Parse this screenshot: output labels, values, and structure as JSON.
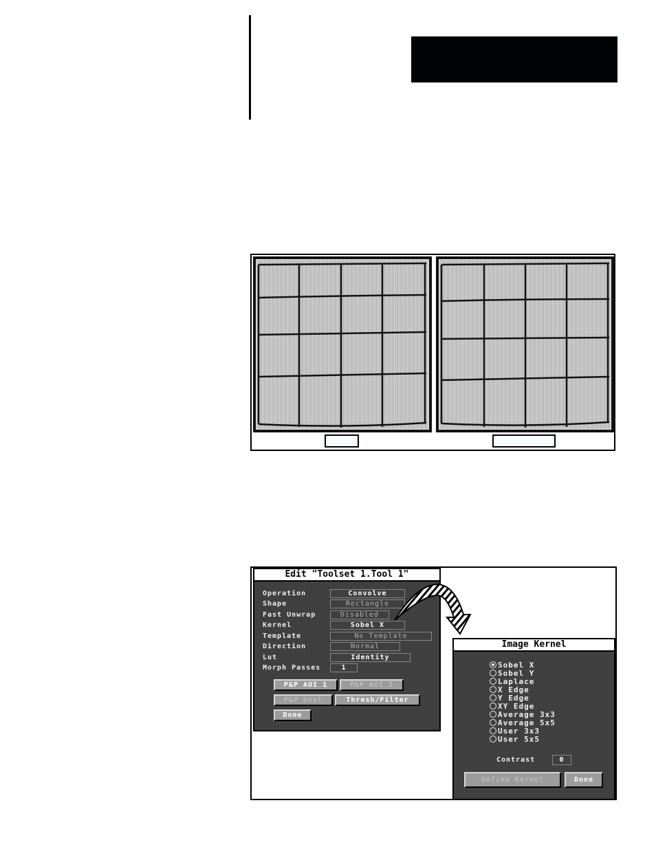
{
  "page": {
    "header_tab_text": ""
  },
  "figure1": {
    "left_image": "grid-image-before",
    "right_image": "grid-image-after",
    "left_caption": "",
    "right_caption": ""
  },
  "edit_dialog": {
    "title": "Edit \"Toolset 1.Tool 1\"",
    "fields": [
      {
        "label": "Operation",
        "value": "Convolve",
        "enabled": true
      },
      {
        "label": "Shape",
        "value": "Rectangle",
        "enabled": false
      },
      {
        "label": "Fast Unwrap",
        "value": "Disabled",
        "enabled": false
      },
      {
        "label": "Kernel",
        "value": "Sobel X",
        "enabled": true
      },
      {
        "label": "Template",
        "value": "No Template",
        "enabled": false
      },
      {
        "label": "Direction",
        "value": "Normal",
        "enabled": false
      },
      {
        "label": "Lut",
        "value": "Identity",
        "enabled": true
      },
      {
        "label": "Morph Passes",
        "value": "1",
        "enabled": true
      }
    ],
    "buttons": [
      {
        "label": "P&P AOI 1",
        "enabled": true
      },
      {
        "label": "P&P AOI 2",
        "enabled": false
      },
      {
        "label": "P&P Dest",
        "enabled": false
      },
      {
        "label": "Thresh/Filter",
        "enabled": true
      },
      {
        "label": "Done",
        "enabled": true
      }
    ]
  },
  "arrow": {
    "icon": "curved-hatched-arrow-icon"
  },
  "kernel_dialog": {
    "title": "Image Kernel",
    "options": [
      {
        "label": "Sobel X",
        "selected": true
      },
      {
        "label": "Sobel Y",
        "selected": false
      },
      {
        "label": "Laplace",
        "selected": false
      },
      {
        "label": "X Edge",
        "selected": false
      },
      {
        "label": "Y Edge",
        "selected": false
      },
      {
        "label": "XY Edge",
        "selected": false
      },
      {
        "label": "Average 3x3",
        "selected": false
      },
      {
        "label": "Average 5x5",
        "selected": false
      },
      {
        "label": "User 3x3",
        "selected": false
      },
      {
        "label": "User 5x5",
        "selected": false
      }
    ],
    "contrast_label": "Contrast",
    "contrast_value": "0",
    "define_kernel_label": "Define Kernel",
    "done_label": "Done"
  },
  "colors": {
    "dialog_bg": "#404040",
    "button_bg": "#9c9c9c",
    "text_light": "#f0f0f0"
  }
}
